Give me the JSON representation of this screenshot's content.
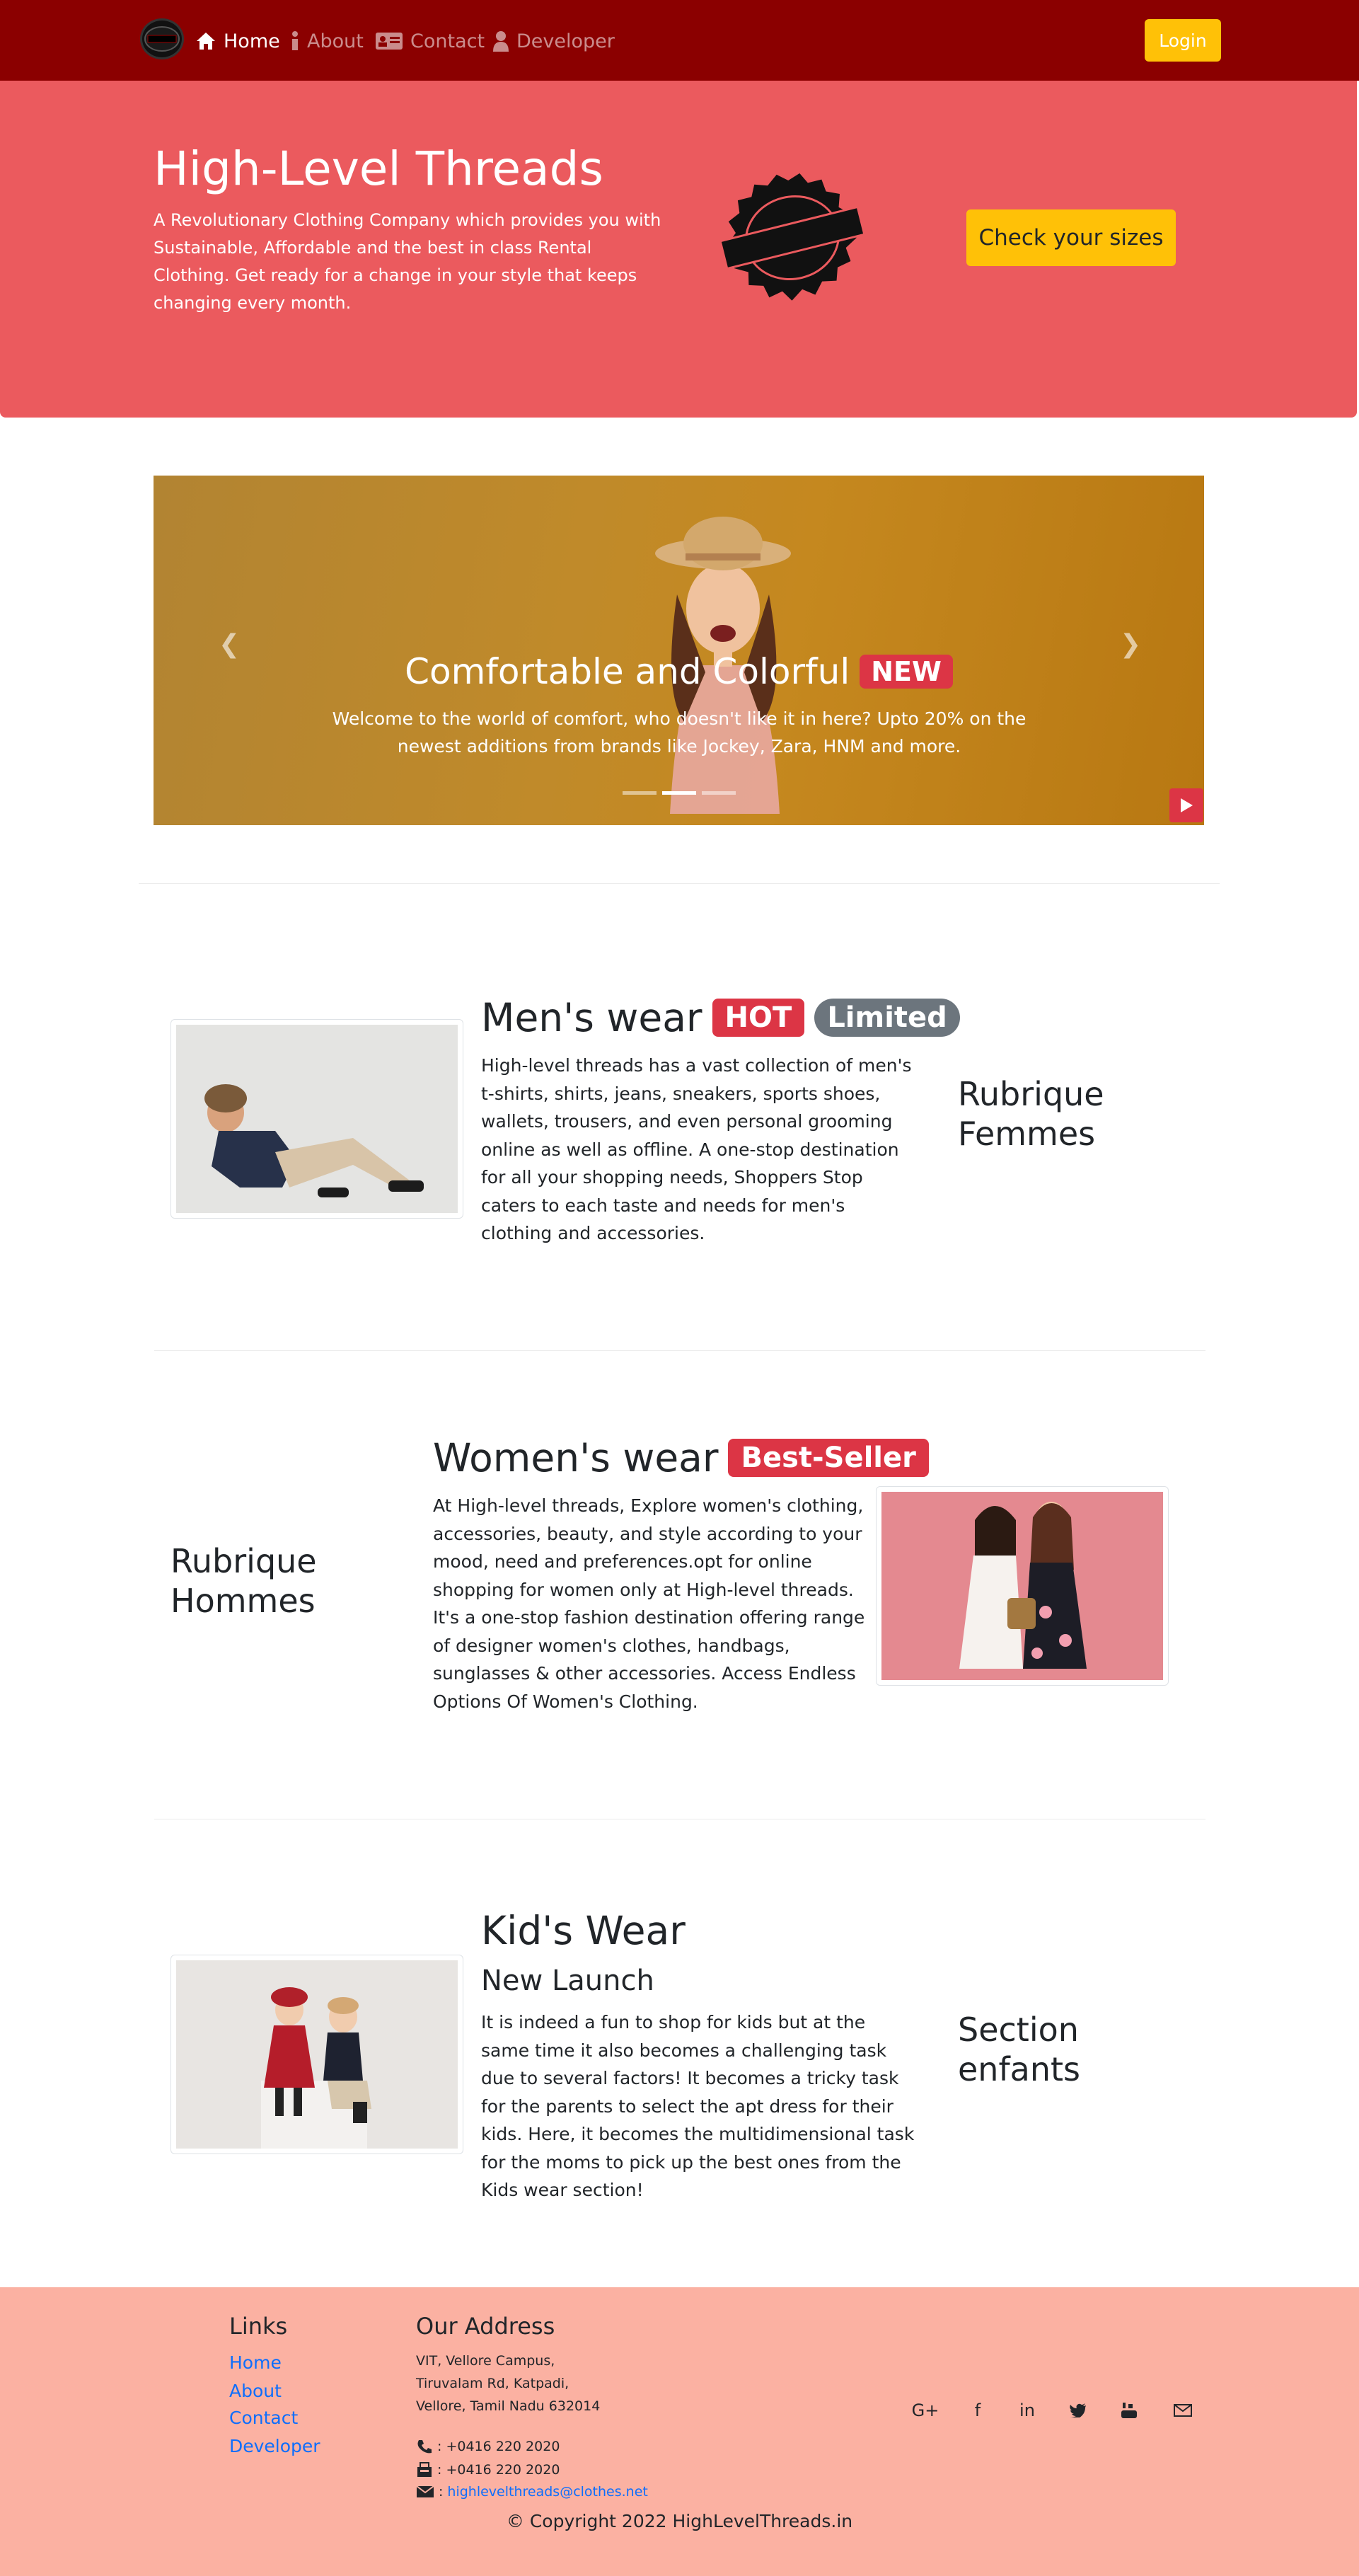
{
  "navbar": {
    "logo_text": "RENT CLOTHES",
    "items": [
      {
        "label": "Home",
        "icon": "home-icon"
      },
      {
        "label": "About",
        "icon": "info-icon"
      },
      {
        "label": "Contact",
        "icon": "contact-card-icon"
      },
      {
        "label": "Developer",
        "icon": "user-icon"
      }
    ],
    "login_label": "Login"
  },
  "hero": {
    "title": "High-Level Threads",
    "description": "A Revolutionary Clothing Company which provides you with Sustainable, Affordable and the best in class Rental Clothing. Get ready for a change in your style that keeps changing every month.",
    "seal_text": "RENT CLOTHES",
    "button_label": "Check your sizes"
  },
  "carousel": {
    "title": "Comfortable and Colorful",
    "badge": "NEW",
    "text": "Welcome to the world of comfort, who doesn't like it in here? Upto 20% on the newest additions from brands like Jockey, Zara, HNM and more.",
    "indicator_count": 3,
    "active_index": 1
  },
  "sections": {
    "mens": {
      "title": "Men's wear",
      "badges": [
        "HOT",
        "Limited"
      ],
      "text": "High-level threads has a vast collection of men's t-shirts, shirts, jeans, sneakers, sports shoes, wallets, trousers, and even personal grooming online as well as offline. A one-stop destination for all your shopping needs, Shoppers Stop caters to each taste and needs for men's clothing and accessories.",
      "side_heading": "Rubrique Femmes"
    },
    "womens": {
      "title": "Women's wear",
      "badge": "Best-Seller",
      "text": "At High-level threads, Explore women's clothing, accessories, beauty, and style according to your mood, need and preferences.opt for online shopping for women only at High-level threads. It's a one-stop fashion destination offering range of designer women's clothes, handbags, sunglasses & other accessories. Access Endless Options Of Women's Clothing.",
      "side_heading": "Rubrique Hommes"
    },
    "kids": {
      "title": "Kid's Wear",
      "subtitle": "New Launch",
      "text": "It is indeed a fun to shop for kids but at the same time it also becomes a challenging task due to several factors! It becomes a tricky task for the parents to select the apt dress for their kids. Here, it becomes the multidimensional task for the moms to pick up the best ones from the Kids wear section!",
      "side_heading": "Section enfants"
    }
  },
  "footer": {
    "links_heading": "Links",
    "links": [
      "Home",
      "About",
      "Contact",
      "Developer"
    ],
    "address_heading": "Our Address",
    "address_lines": [
      "VIT, Vellore Campus,",
      "Tiruvalam Rd, Katpadi,",
      "Vellore, Tamil Nadu 632014"
    ],
    "phone": ": +0416 220 2020",
    "fax": ": +0416 220 2020",
    "email": "highlevelthreads@clothes.net",
    "social_icons": [
      "google-plus-icon",
      "facebook-icon",
      "linkedin-icon",
      "twitter-icon",
      "youtube-icon",
      "mail-icon"
    ],
    "copyright": "© Copyright 2022 HighLevelThreads.in"
  },
  "colors": {
    "navbar": "#8b0000",
    "hero": "#eb5a5e",
    "accent_yellow": "#ffc107",
    "badge_red": "#dc3545",
    "badge_grey": "#6c757d",
    "footer": "#fbb1a2",
    "link": "#0d6efd"
  }
}
